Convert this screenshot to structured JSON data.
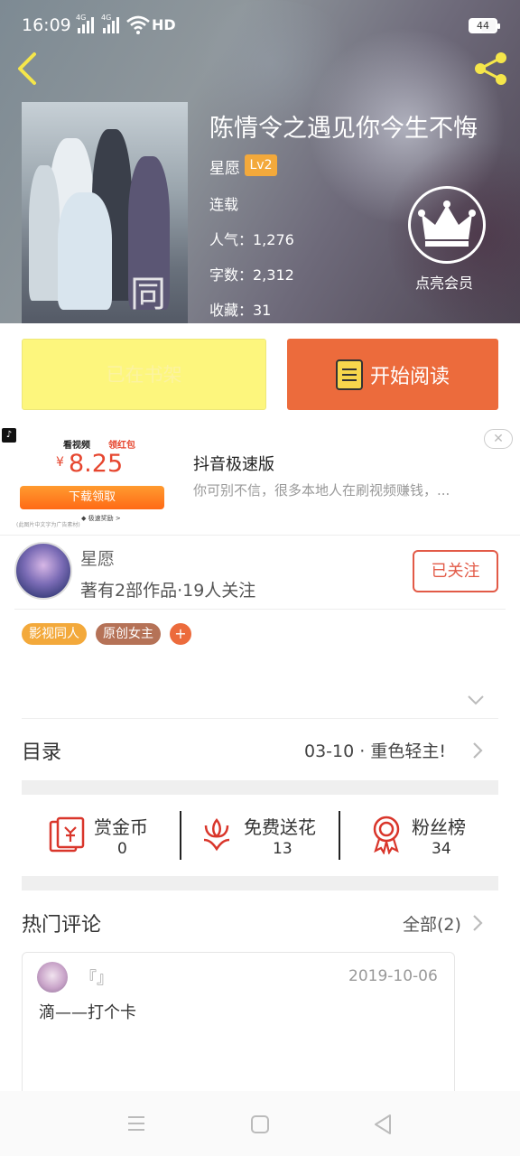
{
  "status_bar": {
    "time": "16:09",
    "net1": "4G",
    "net2": "4G",
    "hd": "HD",
    "battery": "44"
  },
  "book": {
    "title": "陈情令之遇见你今生不悔",
    "author": "星愿",
    "level": "Lv2",
    "status": "连载",
    "popularity": "人气：1,276",
    "word_count": "字数：2,312",
    "favorites": "收藏：31",
    "cover_text": "同 道",
    "vip_label": "点亮会员"
  },
  "actions": {
    "shelf_label": "已在书架",
    "read_label": "开始阅读"
  },
  "ad": {
    "logo": "♪",
    "img_text1": "看视频",
    "img_text2": "领红包",
    "currency": "¥",
    "amount": "8.25",
    "download": "下载领取",
    "small": "◆ 极速奖励 >",
    "tiny": "(此图片中文字为广告素材)",
    "title": "抖音极速版",
    "desc": "你可别不信，很多本地人在刷视频赚钱，...",
    "close": "✕"
  },
  "author_card": {
    "name": "星愿",
    "info": "著有2部作品·19人关注",
    "follow_label": "已关注"
  },
  "tags": [
    {
      "label": "影视同人",
      "color": "#f3a93b"
    },
    {
      "label": "原创女主",
      "color": "#b57257"
    }
  ],
  "tag_add": "+",
  "toc": {
    "label": "目录",
    "latest": "03-10 · 重色轻主!"
  },
  "stats": [
    {
      "label": "赏金币",
      "value": "0"
    },
    {
      "label": "免费送花",
      "value": "13"
    },
    {
      "label": "粉丝榜",
      "value": "34"
    }
  ],
  "comments": {
    "label": "热门评论",
    "all_label": "全部(2)",
    "items": [
      {
        "user": "『』",
        "date": "2019-10-06",
        "text": "滴——打个卡"
      }
    ]
  },
  "colors": {
    "accent": "#ec6b3c",
    "shelf_bg": "#fdf67d",
    "follow": "#e25a47",
    "icon_red": "#d9362b"
  }
}
